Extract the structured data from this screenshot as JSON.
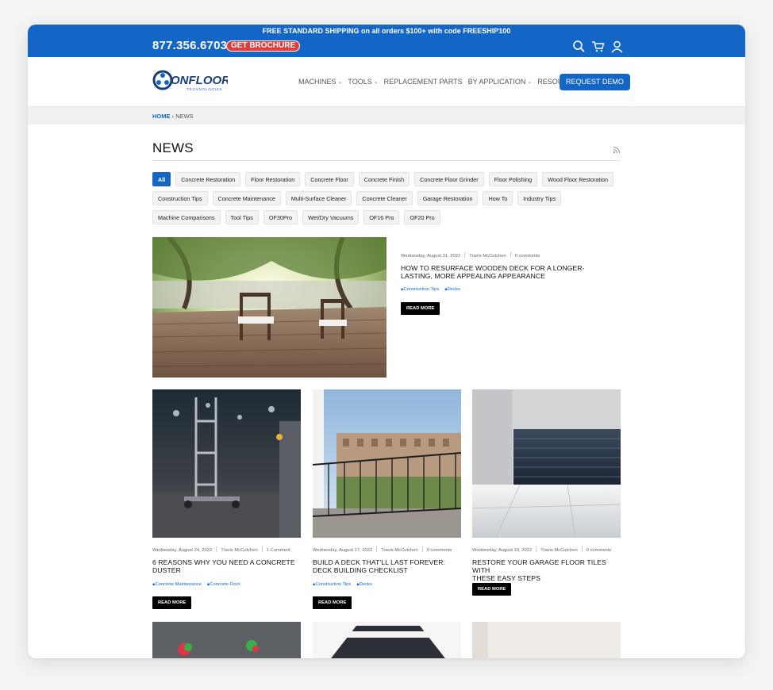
{
  "topbar": {
    "promo": "FREE STANDARD SHIPPING on all orders $100+ with code FREESHIP100",
    "phone": "877.356.6703",
    "brochure": "GET BROCHURE",
    "icons": [
      "search-icon",
      "cart-icon",
      "user-icon"
    ]
  },
  "header": {
    "logo_word": "ONFLOOR",
    "logo_sub": "TECHNOLOGIES",
    "nav": [
      {
        "label": "MACHINES",
        "dropdown": true
      },
      {
        "label": "TOOLS",
        "dropdown": true
      },
      {
        "label": "REPLACEMENT PARTS",
        "dropdown": false
      },
      {
        "label": "BY APPLICATION",
        "dropdown": true
      },
      {
        "label": "RESOURCES",
        "dropdown": true
      }
    ],
    "cta": "REQUEST DEMO"
  },
  "breadcrumb": {
    "home": "HOME",
    "separator": "›",
    "current": "NEWS"
  },
  "page_title": "NEWS",
  "tags": [
    "All",
    "Concrete Restoration",
    "Floor Restoration",
    "Concrete Floor",
    "Concrete Finish",
    "Concrete Floor Grinder",
    "Floor Polishing",
    "Wood Floor Restoration",
    "Construction Tips",
    "Concrete Maintenance",
    "Multi-Surface Cleaner",
    "Concrete Cleaner",
    "Garage Restoration",
    "How To",
    "Industry Tips",
    "Machine Comparisons",
    "Tool Tips",
    "OF30Pro",
    "Wet/Dry Vacuums",
    "OF16 Pro",
    "OF20 Pro"
  ],
  "active_tag": "All",
  "featured": {
    "date": "Wednesday, August 31, 2022",
    "author": "Travis McCutchen",
    "comments": "0 comments",
    "title_line1": "HOW TO RESURFACE WOODEN DECK FOR A LONGER-",
    "title_line2": "LASTING, MORE APPEALING APPEARANCE",
    "tags": [
      "Construction Tips",
      "Decks"
    ],
    "read_more": "READ MORE"
  },
  "posts": [
    {
      "date": "Wednesday, August 24, 2022",
      "author": "Travis McCutchen",
      "comments": "1 Comment",
      "title_line1": "6 REASONS WHY YOU NEED A CONCRETE",
      "title_line2": "DUSTER",
      "tags": [
        "Concrete Maintenance",
        "Concrete Floor"
      ],
      "read_more": "READ MORE"
    },
    {
      "date": "Wednesday, August 17, 2022",
      "author": "Travis McCutchen",
      "comments": "0 comments",
      "title_line1": "BUILD A DECK THAT'LL LAST FOREVER:",
      "title_line2": "DECK BUILDING CHECKLIST",
      "tags": [
        "Construction Tips",
        "Decks"
      ],
      "read_more": "READ MORE"
    },
    {
      "date": "Wednesday, August 10, 2022",
      "author": "Travis McCutchen",
      "comments": "0 comments",
      "title_line1": "RESTORE YOUR GARAGE FLOOR TILES WITH",
      "title_line2": "THESE EASY STEPS",
      "tags": [],
      "read_more": "READ MORE"
    }
  ],
  "colors": {
    "brand_blue": "#1466c6",
    "brochure_red": "#e23b3b",
    "button_black": "#000000"
  }
}
